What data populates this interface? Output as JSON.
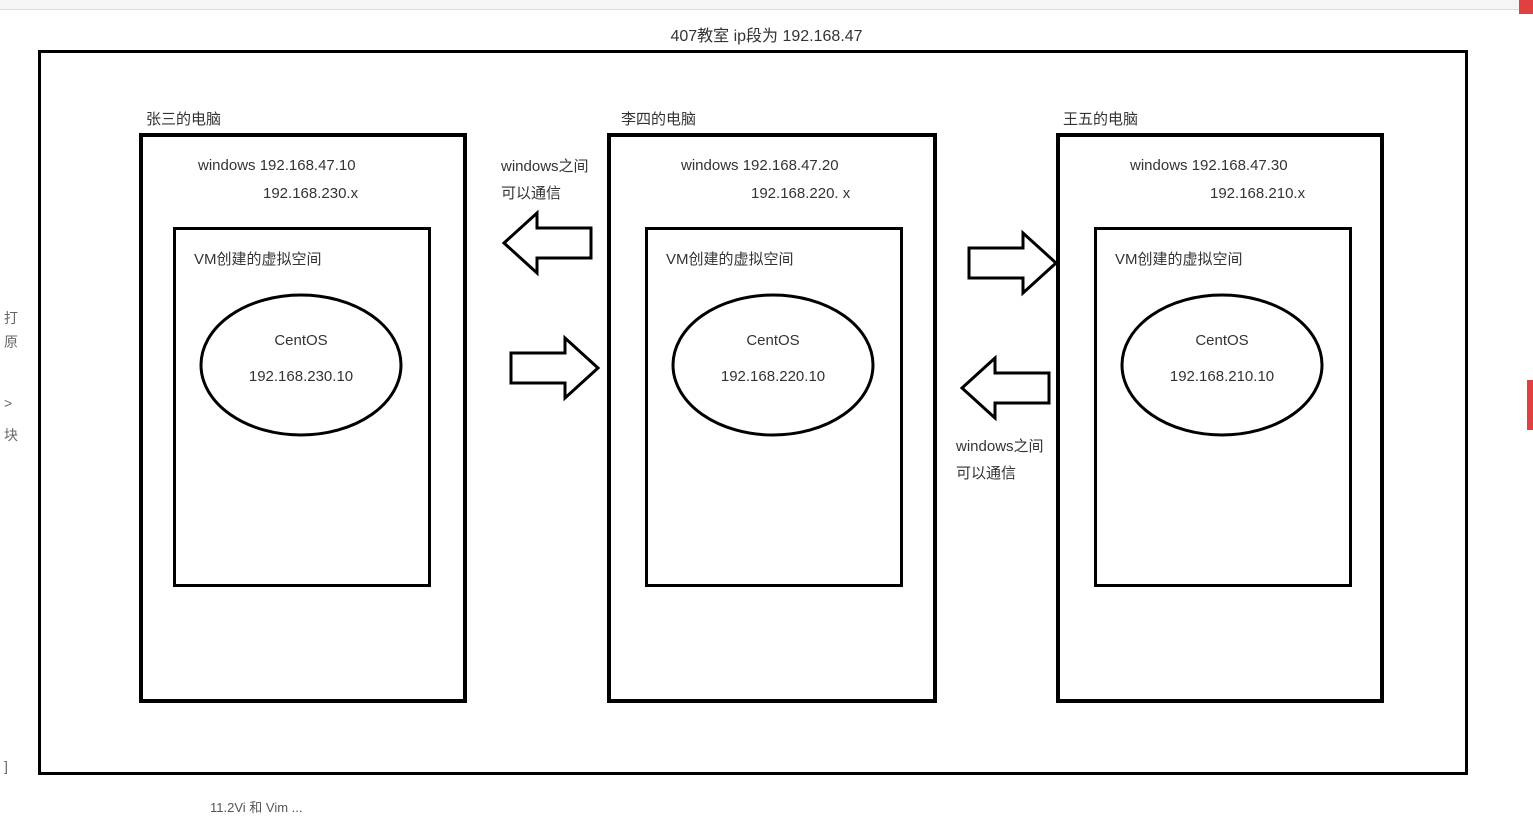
{
  "title": "407教室    ip段为  192.168.47",
  "computers": [
    {
      "owner": "张三的电脑",
      "win_ip": "windows  192.168.47.10",
      "nat_ip": "192.168.230.x",
      "vm_title": "VM创建的虚拟空间",
      "os": "CentOS",
      "vm_ip": "192.168.230.10"
    },
    {
      "owner": "李四的电脑",
      "win_ip": "windows  192.168.47.20",
      "nat_ip": "192.168.220. x",
      "vm_title": "VM创建的虚拟空间",
      "os": "CentOS",
      "vm_ip": "192.168.220.10"
    },
    {
      "owner": "王五的电脑",
      "win_ip": "windows  192.168.47.30",
      "nat_ip": "192.168.210.x",
      "vm_title": "VM创建的虚拟空间",
      "os": "CentOS",
      "vm_ip": "192.168.210.10"
    }
  ],
  "notes": {
    "left_top": "windows之间\n可以通信",
    "right_bottom": "windows之间\n可以通信"
  },
  "sidebar": {
    "t1": "打",
    "t2": "原",
    "t3": ">",
    "t4": "块",
    "t5": "]"
  },
  "bottom": "11.2Vi 和 Vim  ..."
}
